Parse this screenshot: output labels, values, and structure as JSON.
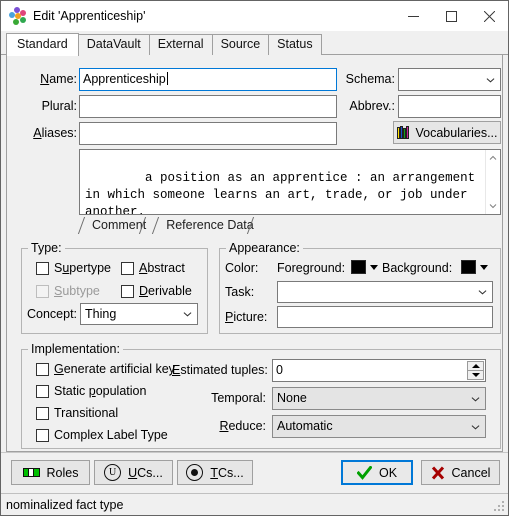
{
  "window": {
    "title": "Edit 'Apprenticeship'",
    "icon": "color-dots-icon",
    "controls": {
      "minimize": "–",
      "maximize": "□",
      "close": "×"
    }
  },
  "tabs": [
    {
      "label": "Standard",
      "active": true
    },
    {
      "label": "DataVault",
      "active": false
    },
    {
      "label": "External",
      "active": false
    },
    {
      "label": "Source",
      "active": false
    },
    {
      "label": "Status",
      "active": false
    }
  ],
  "fields": {
    "name_label": "Name:",
    "name_accel": "N",
    "name_value": "Apprenticeship",
    "plural_label": "Plural:",
    "plural_value": "",
    "aliases_label": "Aliases:",
    "aliases_accel": "A",
    "aliases_value": "",
    "schema_label": "Schema:",
    "schema_value": "",
    "abbrev_label": "Abbrev.:",
    "abbrev_value": "",
    "vocabularies_label": "Vocabularies..."
  },
  "memo": {
    "text": "a position as an apprentice : an arrangement in which someone learns an art, trade, or job under another.",
    "subtabs": [
      {
        "label": "Comment",
        "active": true
      },
      {
        "label": "Reference Data",
        "active": false
      }
    ]
  },
  "type_group": {
    "title": "Type:",
    "checkboxes": [
      {
        "label": "Supertype",
        "accel": "u",
        "checked": false,
        "disabled": false
      },
      {
        "label": "Abstract",
        "accel": "A",
        "checked": false,
        "disabled": false
      },
      {
        "label": "Subtype",
        "accel": "S",
        "checked": false,
        "disabled": true
      },
      {
        "label": "Derivable",
        "accel": "D",
        "checked": false,
        "disabled": false
      }
    ],
    "concept_label": "Concept:",
    "concept_value": "Thing"
  },
  "appearance_group": {
    "title": "Appearance:",
    "color_label": "Color:",
    "foreground_label": "Foreground:",
    "foreground_color": "#000000",
    "background_label": "Background:",
    "background_color": "#000000",
    "task_label": "Task:",
    "task_value": "",
    "picture_label": "Picture:",
    "picture_accel": "P",
    "picture_value": ""
  },
  "implementation_group": {
    "title": "Implementation:",
    "checkboxes": [
      {
        "label": "Generate artificial key",
        "accel": "G",
        "checked": false
      },
      {
        "label": "Static population",
        "accel": "p",
        "checked": false
      },
      {
        "label": "Transitional",
        "accel": "",
        "checked": false
      },
      {
        "label": "Complex Label Type",
        "accel": "",
        "checked": false
      }
    ],
    "estimated_tuples_label": "Estimated tuples:",
    "estimated_tuples_accel": "E",
    "estimated_tuples_value": "0",
    "temporal_label": "Temporal:",
    "temporal_value": "None",
    "reduce_label": "Reduce:",
    "reduce_accel": "R",
    "reduce_value": "Automatic"
  },
  "buttons": {
    "roles": "Roles",
    "ucs": "UCs...",
    "ucs_accel": "U",
    "tcs": "TCs...",
    "tcs_accel": "T",
    "ok": "OK",
    "cancel": "Cancel"
  },
  "statusbar": {
    "text": "nominalized fact type"
  }
}
